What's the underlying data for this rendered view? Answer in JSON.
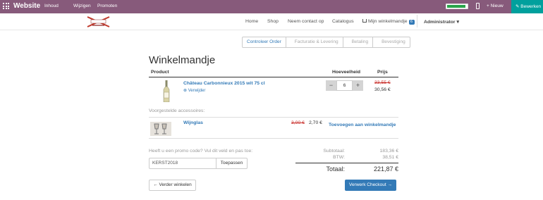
{
  "topbar": {
    "brand": "Website",
    "menu": [
      "Inhoud",
      "Wijzigen",
      "Promoten"
    ],
    "new_label": "+ Nieuw",
    "edit_label": "Bewerken"
  },
  "nav": {
    "items": [
      "Home",
      "Shop",
      "Neem contact op",
      "Catalogus"
    ],
    "cart_label": "Mijn winkelmandje",
    "cart_count": "6",
    "user": "Administrator ▾"
  },
  "wizard": [
    "Controleer Order",
    "Facturatie & Levering",
    "Betaling",
    "Bevestiging"
  ],
  "page_title": "Winkelmandje",
  "table_headers": {
    "product": "Product",
    "quantity": "Hoeveelheid",
    "price": "Prijs"
  },
  "line_item": {
    "name": "Château Carbonnieux 2015 wit 75 cl",
    "remove_label": "⊗ Verwijder",
    "quantity": "6",
    "minus": "−",
    "plus": "+",
    "old_price": "33,55 €",
    "price": "30,56 €"
  },
  "suggested_label": "Voorgestelde accessoires:",
  "accessory": {
    "name": "Wijnglas",
    "old_price": "3,00 €",
    "price": "2,70 €",
    "add_label": "Toevoegen aan winkelmandje"
  },
  "promo": {
    "question": "Heeft u een promo code? Vul dit veld en pas toe:",
    "value": "KERST2018",
    "apply_label": "Toepassen"
  },
  "summary": {
    "subtotal_label": "Subtotaal:",
    "subtotal": "183,36 €",
    "tax_label": "BTW:",
    "tax": "38,51 €",
    "total_label": "Totaal:",
    "total": "221,87 €"
  },
  "buttons": {
    "continue": "← Verder winkelen",
    "checkout": "Verwerk Checkout →"
  },
  "colors": {
    "topbar": "#875a7b",
    "edit": "#00a09d",
    "primary": "#337ab7",
    "strike": "#c9302c"
  }
}
